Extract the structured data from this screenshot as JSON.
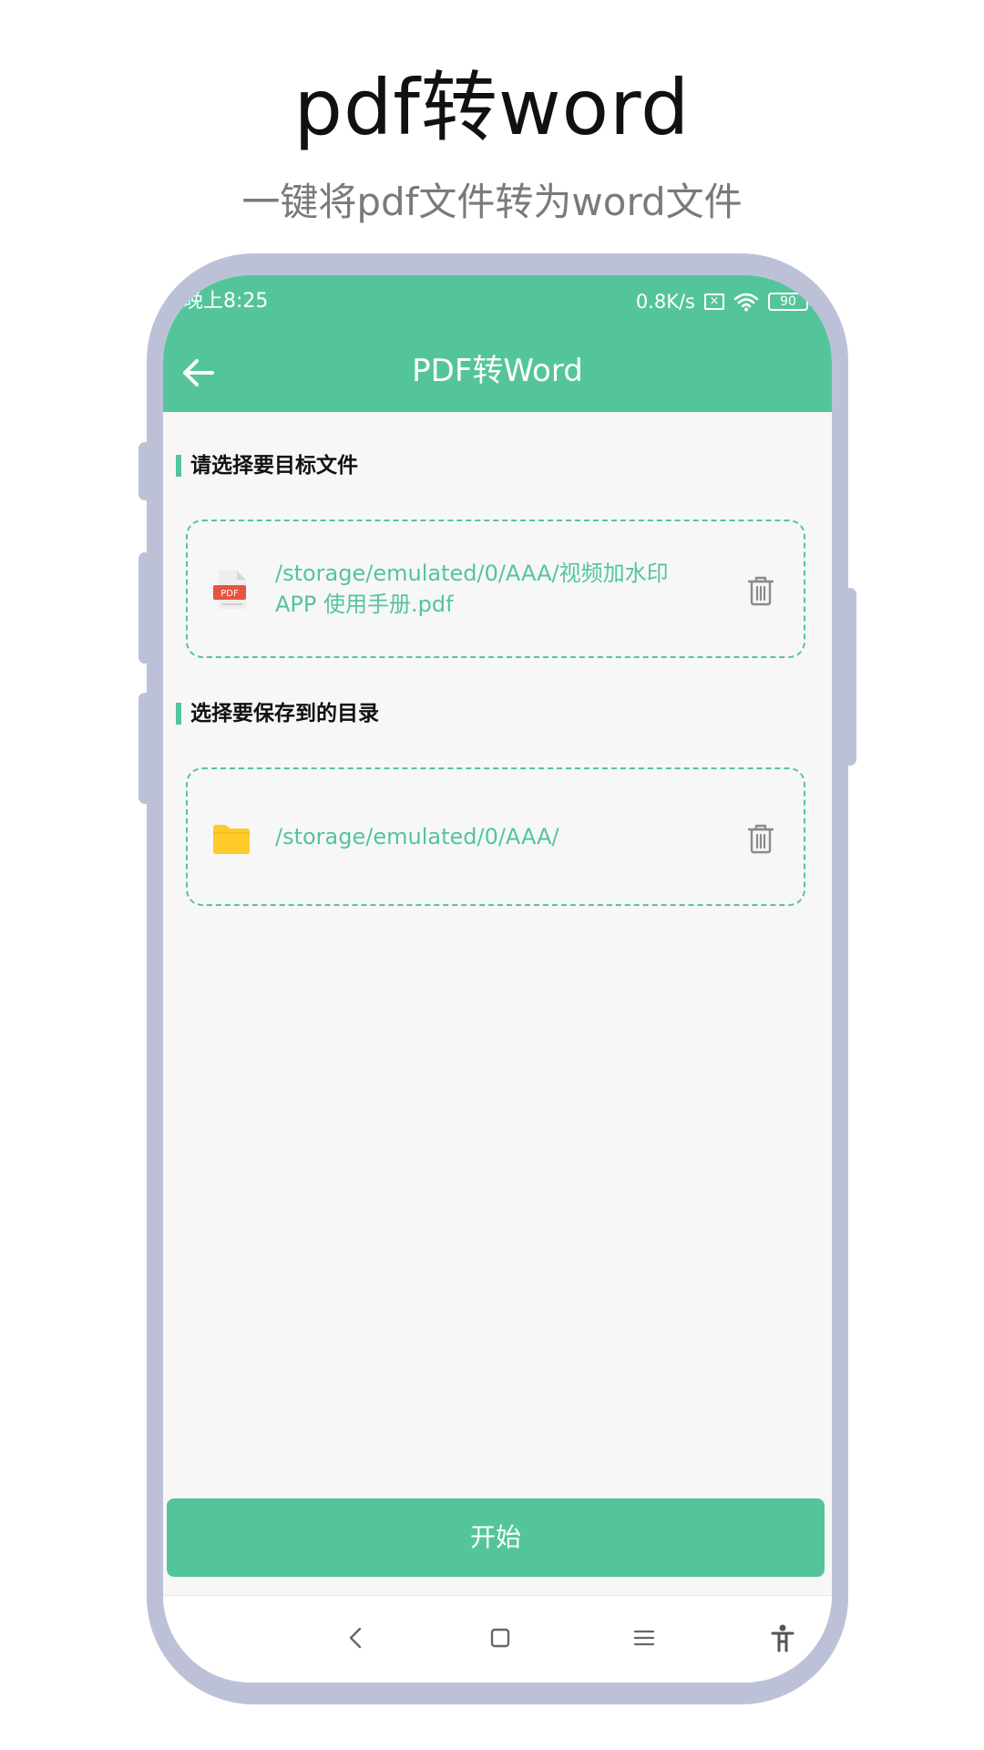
{
  "promo": {
    "title": "pdf转word",
    "subtitle": "一键将pdf文件转为word文件"
  },
  "status_bar": {
    "time": "晚上8:25",
    "net_speed": "0.8K/s",
    "sim_icon": "sim-x-icon",
    "wifi_icon": "wifi-icon",
    "battery_level": "90"
  },
  "header": {
    "back_icon": "arrow-left-icon",
    "title": "PDF转Word"
  },
  "sections": [
    {
      "label": "请选择要目标文件",
      "path": "/storage/emulated/0/AAA/视频加水印APP 使用手册.pdf",
      "icon": "pdf-file-icon",
      "action_icon": "trash-icon"
    },
    {
      "label": "选择要保存到的目录",
      "path": "/storage/emulated/0/AAA/",
      "icon": "folder-icon",
      "action_icon": "trash-icon"
    }
  ],
  "start_button": "开始",
  "nav_bar": {
    "icons": [
      "chevron-left-icon",
      "square-home-icon",
      "menu-lines-icon",
      "accessibility-icon"
    ]
  },
  "colors": {
    "accent": "#54c59a",
    "frame": "#bdc1d8",
    "screen_bg": "#f7f7f7",
    "folder": "#ffcb2b",
    "pdf_badge": "#e8533f"
  }
}
